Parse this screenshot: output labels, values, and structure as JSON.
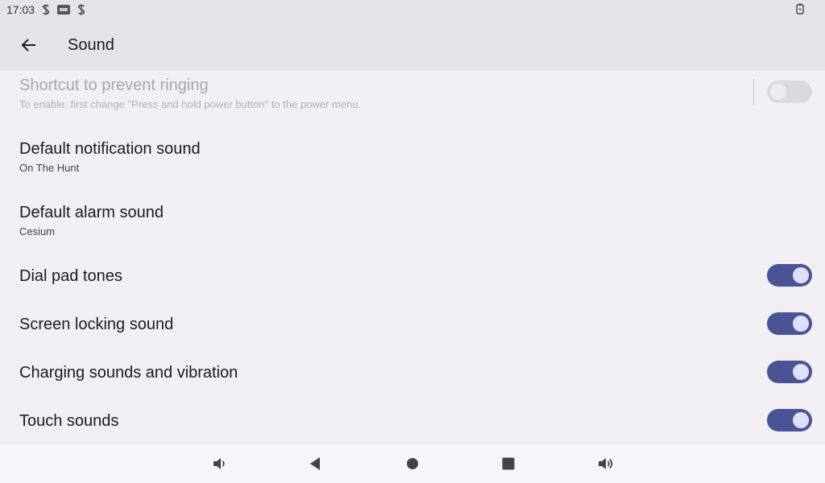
{
  "status_bar": {
    "time": "17:03",
    "icons": [
      "s-icon",
      "dvr-icon",
      "s-icon"
    ],
    "right_icon": "battery-charging-icon"
  },
  "app_bar": {
    "title": "Sound",
    "back_icon": "arrow-back-icon"
  },
  "settings": [
    {
      "title": "Shortcut to prevent ringing",
      "summary": "To enable, first change \"Press and hold power button\" to the power menu.",
      "switch": "off",
      "enabled": false
    },
    {
      "title": "Default notification sound",
      "summary": "On The Hunt"
    },
    {
      "title": "Default alarm sound",
      "summary": "Cesium"
    },
    {
      "title": "Dial pad tones",
      "switch": "on"
    },
    {
      "title": "Screen locking sound",
      "switch": "on"
    },
    {
      "title": "Charging sounds and vibration",
      "switch": "on"
    },
    {
      "title": "Touch sounds",
      "switch": "on"
    }
  ],
  "nav_bar": {
    "buttons": [
      "volume-down-icon",
      "back-triangle-icon",
      "home-circle-icon",
      "recents-square-icon",
      "volume-up-icon"
    ]
  },
  "colors": {
    "accent": "#4a5495",
    "background": "#f1eef4",
    "app_bar": "#e5e2e8"
  }
}
